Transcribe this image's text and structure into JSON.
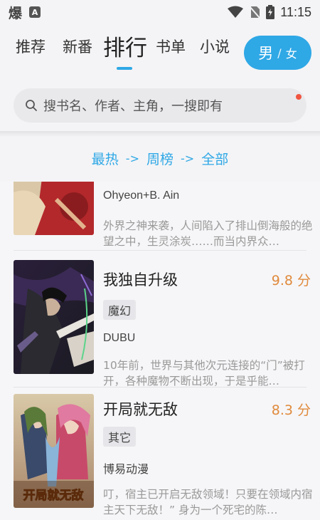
{
  "status_bar": {
    "app_glyph": "爆",
    "notif_glyph": "A",
    "time": "11:15"
  },
  "nav": {
    "tabs": [
      "推荐",
      "新番",
      "排行",
      "书单",
      "小说"
    ],
    "active_tab": "排行",
    "gender": {
      "male": "男",
      "separator": "/",
      "female": "女"
    }
  },
  "search": {
    "placeholder": "搜书名、作者、主角，一搜即有"
  },
  "filter": {
    "parts": [
      "最热",
      "->",
      "周榜",
      "->",
      "全部"
    ]
  },
  "colors": {
    "accent": "#2fa8e6",
    "score": "#e08a3c",
    "dot": "#f0553f"
  },
  "books": [
    {
      "title": "",
      "score": "",
      "tag": "",
      "author": "Ohyeon+B. Ain",
      "desc": "外界之神来袭，人间陷入了排山倒海般的绝望之中，生灵涂炭……而当内界众…"
    },
    {
      "title": "我独自升级",
      "score": "9.8 分",
      "tag": "魔幻",
      "author": "DUBU",
      "desc": "10年前，世界与其他次元连接的“门”被打开，各种魔物不断出现，于是乎能…"
    },
    {
      "title": "开局就无敌",
      "score": "8.3 分",
      "tag": "其它",
      "author": "博易动漫",
      "desc": "叮，宿主已开启无敌领域！只要在领域内宿主天下无敌！” 身为一个死宅的陈…",
      "cover_text": "开局就无敌"
    }
  ]
}
